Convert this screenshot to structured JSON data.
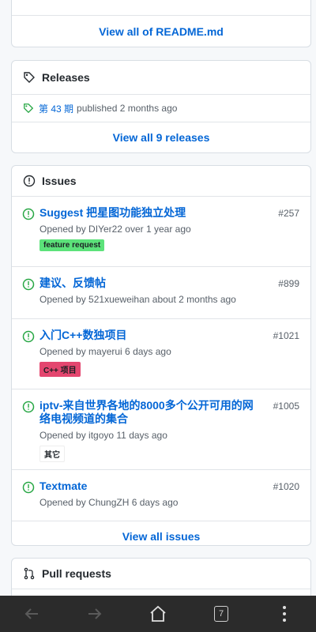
{
  "readme": {
    "view_all": "View all of README.md"
  },
  "releases": {
    "title": "Releases",
    "latest_tag": "第 43 期",
    "latest_meta": "published 2 months ago",
    "view_all": "View all 9 releases"
  },
  "issues": {
    "title": "Issues",
    "items": [
      {
        "title": "Suggest 把星图功能独立处理",
        "number": "#257",
        "meta": "Opened by DIYer22 over 1 year ago",
        "label": "feature request",
        "label_color": "#5ce27a",
        "label_text_color": "#1b1f23"
      },
      {
        "title": "建议、反馈帖",
        "number": "#899",
        "meta": "Opened by 521xueweihan about 2 months ago"
      },
      {
        "title": "入门C++数独项目",
        "number": "#1021",
        "meta": "Opened by mayerui 6 days ago",
        "label": "C++ 项目",
        "label_color": "#e4466f",
        "label_text_color": "#1b1f23"
      },
      {
        "title": "iptv-来自世界各地的8000多个公开可用的网络电视频道的集合",
        "number": "#1005",
        "meta": "Opened by itgoyo 11 days ago",
        "label": "其它",
        "label_color": "#ffffff",
        "label_text_color": "#24292e"
      },
      {
        "title": "Textmate",
        "number": "#1020",
        "meta": "Opened by ChungZH 6 days ago"
      }
    ],
    "view_all": "View all issues"
  },
  "pulls": {
    "title": "Pull requests"
  },
  "navbar": {
    "tab_count": "7"
  },
  "colors": {
    "link": "#0366d6",
    "open_issue": "#28a745",
    "navbar": "#2b2b2b"
  }
}
